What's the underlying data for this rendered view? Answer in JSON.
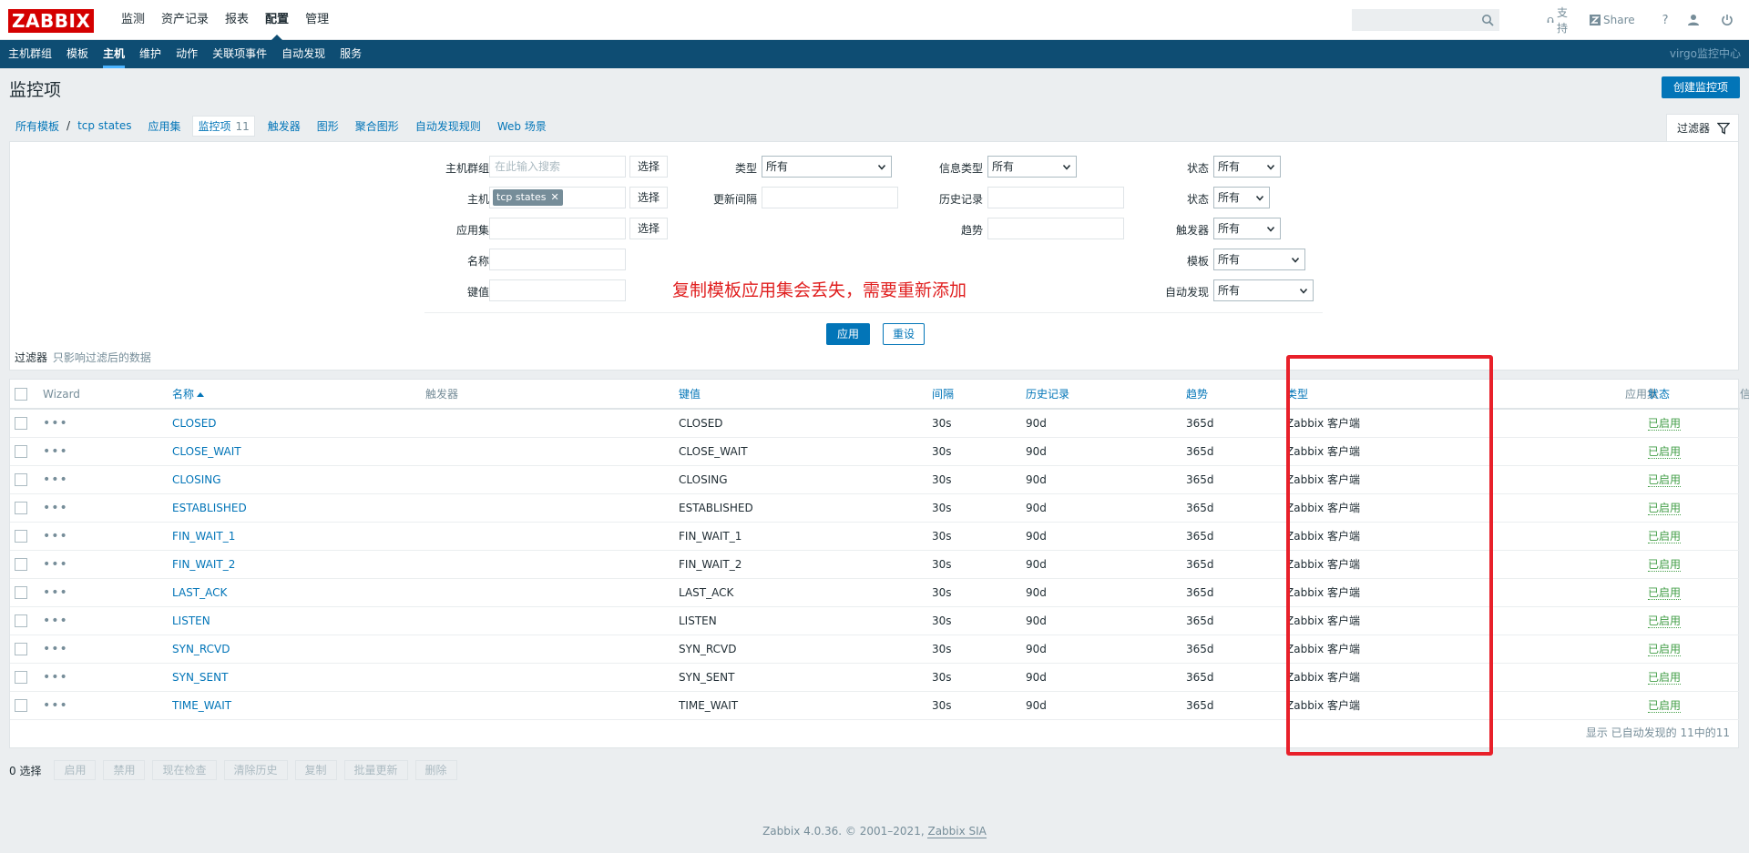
{
  "logo": "ZABBIX",
  "top_nav": [
    "监测",
    "资产记录",
    "报表",
    "配置",
    "管理"
  ],
  "top_right": {
    "support": "支持",
    "share": "Share",
    "help": "?"
  },
  "sub_nav": [
    "主机群组",
    "模板",
    "主机",
    "维护",
    "动作",
    "关联项事件",
    "自动发现",
    "服务"
  ],
  "site_name": "virgo监控中心",
  "page": {
    "title": "监控项",
    "create_button": "创建监控项"
  },
  "breadcrumbs": {
    "all_templates": "所有模板",
    "separator": "/",
    "template": "tcp states",
    "tabs": [
      {
        "label": "应用集"
      },
      {
        "label": "监控项",
        "count": "11"
      },
      {
        "label": "触发器"
      },
      {
        "label": "图形"
      },
      {
        "label": "聚合图形"
      },
      {
        "label": "自动发现规则"
      },
      {
        "label": "Web 场景"
      }
    ]
  },
  "filter": {
    "tab_label": "过滤器",
    "host_group_label": "主机群组",
    "host_group_placeholder": "在此输入搜索",
    "select_label": "选择",
    "host_label": "主机",
    "host_tag": "tcp states",
    "app_label": "应用集",
    "name_label": "名称",
    "key_label": "键值",
    "type_label": "类型",
    "type_value": "所有",
    "interval_label": "更新间隔",
    "info_type_label": "信息类型",
    "info_type_value": "所有",
    "history_label": "历史记录",
    "trends_label": "趋势",
    "state_label": "状态",
    "state_value": "所有",
    "status_label": "状态",
    "status_value": "所有",
    "triggers_label": "触发器",
    "triggers_value": "所有",
    "template_label": "模板",
    "template_value": "所有",
    "discovery_label": "自动发现",
    "discovery_value": "所有",
    "annotation": "复制模板应用集会丢失，需要重新添加",
    "apply": "应用",
    "reset": "重设",
    "note_strong": "过滤器",
    "note_light": "只影响过滤后的数据"
  },
  "table": {
    "headers": {
      "wizard": "Wizard",
      "name": "名称",
      "triggers": "触发器",
      "key": "键值",
      "interval": "间隔",
      "history": "历史记录",
      "trends": "趋势",
      "type": "类型",
      "applications": "应用集",
      "status": "状态",
      "info": "信息"
    },
    "rows": [
      {
        "name": "CLOSED",
        "key": "CLOSED",
        "interval": "30s",
        "history": "90d",
        "trends": "365d",
        "type": "Zabbix 客户端",
        "status": "已启用"
      },
      {
        "name": "CLOSE_WAIT",
        "key": "CLOSE_WAIT",
        "interval": "30s",
        "history": "90d",
        "trends": "365d",
        "type": "Zabbix 客户端",
        "status": "已启用"
      },
      {
        "name": "CLOSING",
        "key": "CLOSING",
        "interval": "30s",
        "history": "90d",
        "trends": "365d",
        "type": "Zabbix 客户端",
        "status": "已启用"
      },
      {
        "name": "ESTABLISHED",
        "key": "ESTABLISHED",
        "interval": "30s",
        "history": "90d",
        "trends": "365d",
        "type": "Zabbix 客户端",
        "status": "已启用"
      },
      {
        "name": "FIN_WAIT_1",
        "key": "FIN_WAIT_1",
        "interval": "30s",
        "history": "90d",
        "trends": "365d",
        "type": "Zabbix 客户端",
        "status": "已启用"
      },
      {
        "name": "FIN_WAIT_2",
        "key": "FIN_WAIT_2",
        "interval": "30s",
        "history": "90d",
        "trends": "365d",
        "type": "Zabbix 客户端",
        "status": "已启用"
      },
      {
        "name": "LAST_ACK",
        "key": "LAST_ACK",
        "interval": "30s",
        "history": "90d",
        "trends": "365d",
        "type": "Zabbix 客户端",
        "status": "已启用"
      },
      {
        "name": "LISTEN",
        "key": "LISTEN",
        "interval": "30s",
        "history": "90d",
        "trends": "365d",
        "type": "Zabbix 客户端",
        "status": "已启用"
      },
      {
        "name": "SYN_RCVD",
        "key": "SYN_RCVD",
        "interval": "30s",
        "history": "90d",
        "trends": "365d",
        "type": "Zabbix 客户端",
        "status": "已启用"
      },
      {
        "name": "SYN_SENT",
        "key": "SYN_SENT",
        "interval": "30s",
        "history": "90d",
        "trends": "365d",
        "type": "Zabbix 客户端",
        "status": "已启用"
      },
      {
        "name": "TIME_WAIT",
        "key": "TIME_WAIT",
        "interval": "30s",
        "history": "90d",
        "trends": "365d",
        "type": "Zabbix 客户端",
        "status": "已启用"
      }
    ],
    "footer": "显示 已自动发现的 11中的11"
  },
  "actions": {
    "selected": "0 选择",
    "buttons": [
      "启用",
      "禁用",
      "现在检查",
      "清除历史",
      "复制",
      "批量更新",
      "删除"
    ]
  },
  "footer": {
    "text": "Zabbix 4.0.36. © 2001–2021,",
    "company": "Zabbix SIA"
  },
  "colors": {
    "brand_red": "#d40000",
    "nav_blue": "#0e4d73",
    "link_blue": "#0275b8",
    "enabled_green": "#429e47",
    "highlight_red": "#e8202a"
  }
}
